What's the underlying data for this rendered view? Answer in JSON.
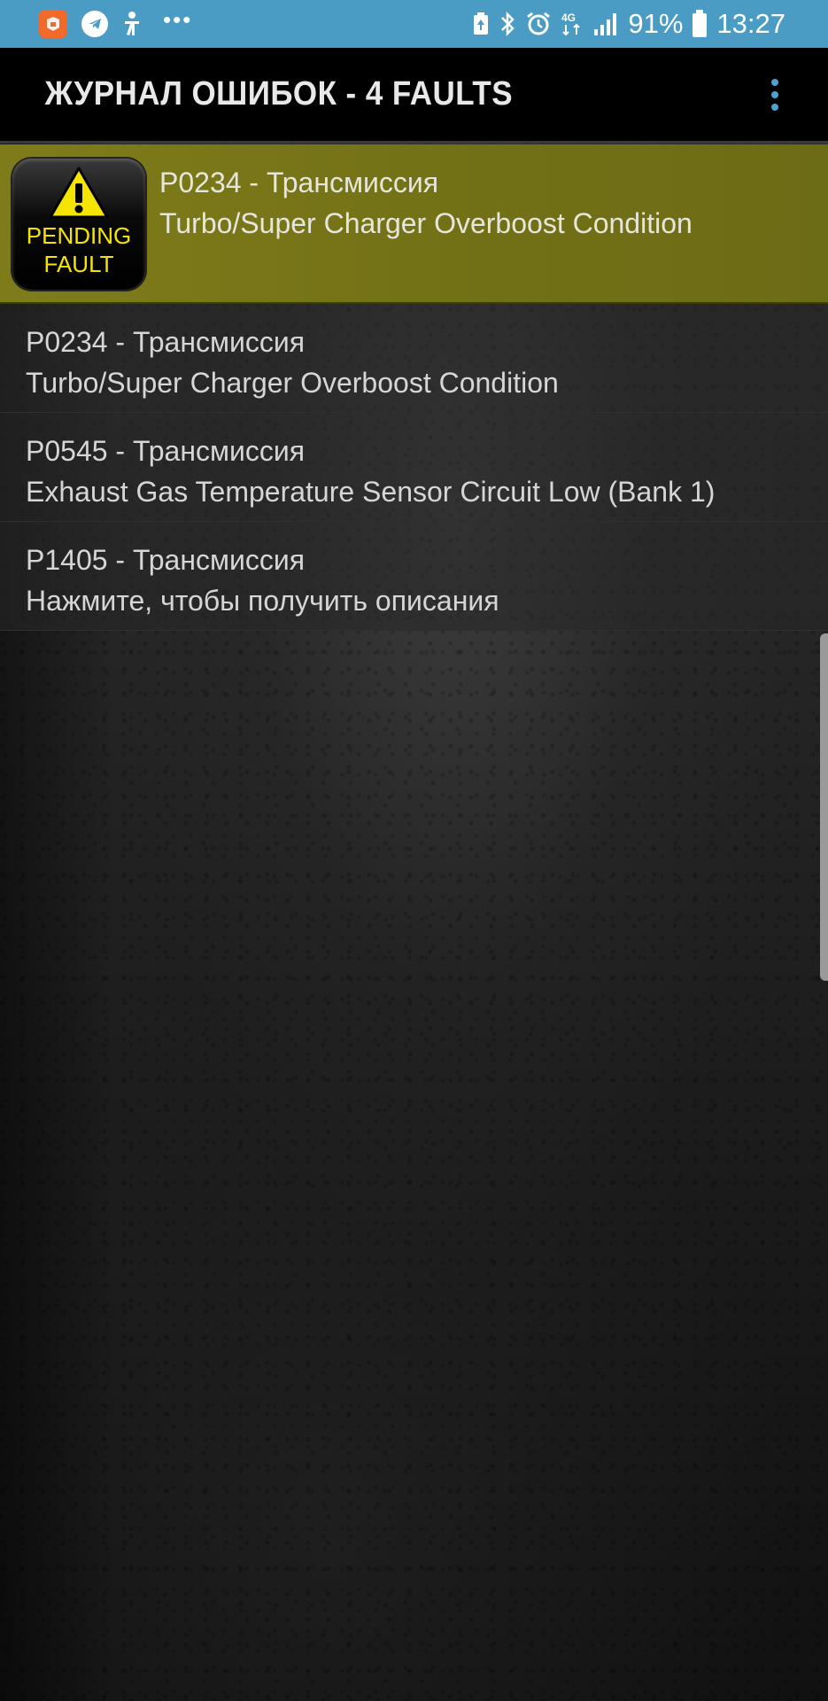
{
  "status_bar": {
    "battery_percent": "91%",
    "time": "13:27",
    "network": "4G",
    "icons": [
      "app-notification-icon",
      "telegram-icon",
      "accessibility-icon",
      "more-notifications-icon",
      "battery-saver-icon",
      "bluetooth-icon",
      "alarm-icon",
      "network-4g-icon",
      "signal-icon",
      "battery-icon"
    ],
    "colors": {
      "background": "#4a9cc4"
    }
  },
  "toolbar": {
    "title": "ЖУРНАЛ ОШИБОК - 4 FAULTS",
    "menu_icon": "overflow-menu-icon"
  },
  "faults": [
    {
      "code": "P0234 - Трансмиссия",
      "description": "Turbo/Super Charger Overboost Condition",
      "pending": true,
      "badge": {
        "line1": "PENDING",
        "line2": "FAULT"
      }
    },
    {
      "code": "P0234 - Трансмиссия",
      "description": "Turbo/Super Charger Overboost Condition",
      "pending": false
    },
    {
      "code": "P0545 - Трансмиссия",
      "description": "Exhaust Gas Temperature Sensor Circuit Low (Bank 1)",
      "pending": false
    },
    {
      "code": "P1405 - Трансмиссия",
      "description": "Нажмите, чтобы получить описания",
      "pending": false
    }
  ],
  "colors": {
    "highlight_row": "#7e7c1a",
    "badge_text": "#f5e400",
    "menu_dots": "#4aa3d0"
  }
}
